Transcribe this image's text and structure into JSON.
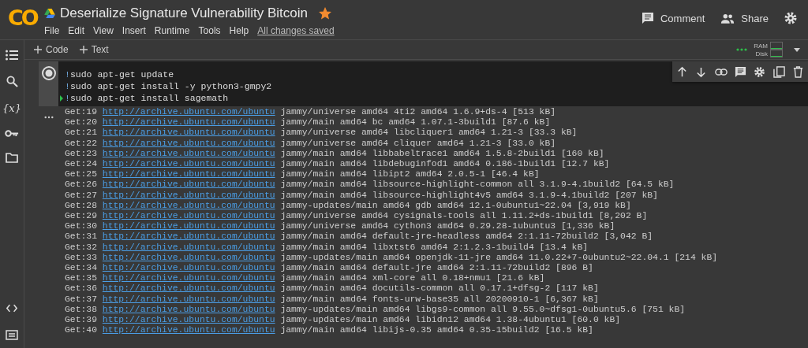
{
  "app": {
    "logo": "CO",
    "title": "Deserialize Signature Vulnerability Bitcoin",
    "starred": true,
    "menu": [
      "File",
      "Edit",
      "View",
      "Insert",
      "Runtime",
      "Tools",
      "Help"
    ],
    "save_status": "All changes saved"
  },
  "header_actions": [
    {
      "kind": "comment",
      "label": "Comment"
    },
    {
      "kind": "share",
      "label": "Share"
    },
    {
      "kind": "settings"
    }
  ],
  "sidebar": {
    "items": [
      {
        "kind": "toc"
      },
      {
        "kind": "search"
      },
      {
        "kind": "glyph",
        "label": "{x}"
      },
      {
        "kind": "key"
      },
      {
        "kind": "folder"
      }
    ],
    "bottom_items": [
      {
        "kind": "code"
      },
      {
        "kind": "terminal"
      }
    ]
  },
  "toolbar": {
    "add_buttons": [
      "Code",
      "Text"
    ],
    "resources": [
      "RAM",
      "Disk"
    ]
  },
  "cell": {
    "lines": [
      {
        "prefix": "!",
        "code": "sudo apt-get update",
        "cursor": false
      },
      {
        "prefix": "!",
        "code": "sudo apt-get install -y python3-gmpy2",
        "cursor": false
      },
      {
        "prefix": "!",
        "code": "sudo apt-get install sagemath",
        "cursor": true
      }
    ]
  },
  "output": {
    "lines": [
      {
        "get": "Get:19",
        "url": "http://archive.ubuntu.com/ubuntu",
        "text": "jammy/universe amd64 4ti2 amd64 1.6.9+ds-4 [513 kB]"
      },
      {
        "get": "Get:20",
        "url": "http://archive.ubuntu.com/ubuntu",
        "text": "jammy/main amd64 bc amd64 1.07.1-3build1 [87.6 kB]"
      },
      {
        "get": "Get:21",
        "url": "http://archive.ubuntu.com/ubuntu",
        "text": "jammy/universe amd64 libcliquer1 amd64 1.21-3 [33.3 kB]"
      },
      {
        "get": "Get:22",
        "url": "http://archive.ubuntu.com/ubuntu",
        "text": "jammy/universe amd64 cliquer amd64 1.21-3 [33.0 kB]"
      },
      {
        "get": "Get:23",
        "url": "http://archive.ubuntu.com/ubuntu",
        "text": "jammy/main amd64 libbabeltrace1 amd64 1.5.8-2build1 [160 kB]"
      },
      {
        "get": "Get:24",
        "url": "http://archive.ubuntu.com/ubuntu",
        "text": "jammy/main amd64 libdebuginfod1 amd64 0.186-1build1 [12.7 kB]"
      },
      {
        "get": "Get:25",
        "url": "http://archive.ubuntu.com/ubuntu",
        "text": "jammy/main amd64 libipt2 amd64 2.0.5-1 [46.4 kB]"
      },
      {
        "get": "Get:26",
        "url": "http://archive.ubuntu.com/ubuntu",
        "text": "jammy/main amd64 libsource-highlight-common all 3.1.9-4.1build2 [64.5 kB]"
      },
      {
        "get": "Get:27",
        "url": "http://archive.ubuntu.com/ubuntu",
        "text": "jammy/main amd64 libsource-highlight4v5 amd64 3.1.9-4.1build2 [207 kB]"
      },
      {
        "get": "Get:28",
        "url": "http://archive.ubuntu.com/ubuntu",
        "text": "jammy-updates/main amd64 gdb amd64 12.1-0ubuntu1~22.04 [3,919 kB]"
      },
      {
        "get": "Get:29",
        "url": "http://archive.ubuntu.com/ubuntu",
        "text": "jammy/universe amd64 cysignals-tools all 1.11.2+ds-1build1 [8,202 B]"
      },
      {
        "get": "Get:30",
        "url": "http://archive.ubuntu.com/ubuntu",
        "text": "jammy/universe amd64 cython3 amd64 0.29.28-1ubuntu3 [1,336 kB]"
      },
      {
        "get": "Get:31",
        "url": "http://archive.ubuntu.com/ubuntu",
        "text": "jammy/main amd64 default-jre-headless amd64 2:1.11-72build2 [3,042 B]"
      },
      {
        "get": "Get:32",
        "url": "http://archive.ubuntu.com/ubuntu",
        "text": "jammy/main amd64 libxtst6 amd64 2:1.2.3-1build4 [13.4 kB]"
      },
      {
        "get": "Get:33",
        "url": "http://archive.ubuntu.com/ubuntu",
        "text": "jammy-updates/main amd64 openjdk-11-jre amd64 11.0.22+7-0ubuntu2~22.04.1 [214 kB]"
      },
      {
        "get": "Get:34",
        "url": "http://archive.ubuntu.com/ubuntu",
        "text": "jammy/main amd64 default-jre amd64 2:1.11-72build2 [896 B]"
      },
      {
        "get": "Get:35",
        "url": "http://archive.ubuntu.com/ubuntu",
        "text": "jammy/main amd64 xml-core all 0.18+nmu1 [21.6 kB]"
      },
      {
        "get": "Get:36",
        "url": "http://archive.ubuntu.com/ubuntu",
        "text": "jammy/main amd64 docutils-common all 0.17.1+dfsg-2 [117 kB]"
      },
      {
        "get": "Get:37",
        "url": "http://archive.ubuntu.com/ubuntu",
        "text": "jammy/main amd64 fonts-urw-base35 all 20200910-1 [6,367 kB]"
      },
      {
        "get": "Get:38",
        "url": "http://archive.ubuntu.com/ubuntu",
        "text": "jammy-updates/main amd64 libgs9-common all 9.55.0~dfsg1-0ubuntu5.6 [751 kB]"
      },
      {
        "get": "Get:39",
        "url": "http://archive.ubuntu.com/ubuntu",
        "text": "jammy-updates/main amd64 libidn12 amd64 1.38-4ubuntu1 [60.0 kB]"
      },
      {
        "get": "Get:40",
        "url": "http://archive.ubuntu.com/ubuntu",
        "text": "jammy/main amd64 libijs-0.35 amd64 0.35-15build2 [16.5 kB]"
      }
    ]
  }
}
